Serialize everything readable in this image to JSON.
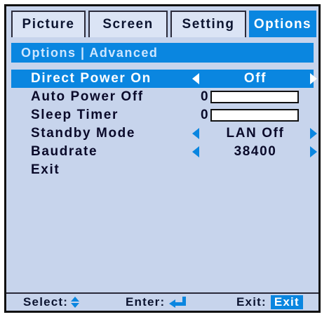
{
  "tabs": [
    {
      "label": "Picture",
      "active": false
    },
    {
      "label": "Screen",
      "active": false
    },
    {
      "label": "Setting",
      "active": false
    },
    {
      "label": "Options",
      "active": true
    }
  ],
  "breadcrumb": "Options | Advanced",
  "menu": {
    "direct_power_on": {
      "label": "Direct Power On",
      "value": "Off",
      "selected": true
    },
    "auto_power_off": {
      "label": "Auto Power Off",
      "value": "0",
      "level": 0
    },
    "sleep_timer": {
      "label": "Sleep Timer",
      "value": "0",
      "level": 0
    },
    "standby_mode": {
      "label": "Standby Mode",
      "value": "LAN Off"
    },
    "baudrate": {
      "label": "Baudrate",
      "value": "38400"
    },
    "exit": {
      "label": "Exit"
    }
  },
  "footer": {
    "select_label": "Select:",
    "enter_label": "Enter:",
    "exit_label": "Exit:",
    "exit_key": "Exit"
  },
  "colors": {
    "accent": "#0a86e0",
    "panel_bg": "#c7d4ec",
    "text": "#0c1430"
  },
  "icons": {
    "select": "up-down-arrows-icon",
    "enter": "enter-return-icon",
    "decrease": "triangle-left-icon",
    "increase": "triangle-right-icon"
  }
}
